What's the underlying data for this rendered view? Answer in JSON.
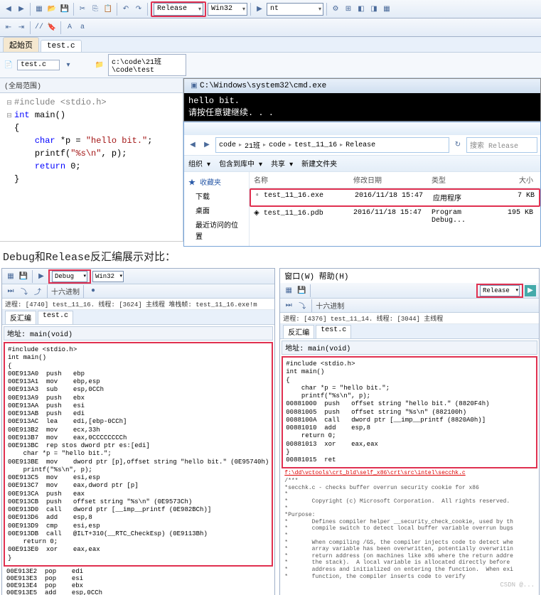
{
  "top_toolbar": {
    "config": "Release",
    "platform": "Win32",
    "target": "nt"
  },
  "tabs": {
    "start": "起始页",
    "file": "test.c"
  },
  "nav": {
    "file": "test.c",
    "path": "c:\\code\\21班\\code\\test"
  },
  "scope": "(全局范围)",
  "code": {
    "l1a": "#include",
    "l1b": "<stdio.h>",
    "l2a": "int",
    "l2b": "main()",
    "l3": "{",
    "l4a": "char",
    "l4b": "*p = ",
    "l4c": "\"hello bit.\"",
    "l4d": ";",
    "l5a": "printf(",
    "l5b": "\"%s\\n\"",
    "l5c": ", p);",
    "l6a": "return",
    "l6b": " 0;",
    "l7": "}"
  },
  "cmd": {
    "title": "C:\\Windows\\system32\\cmd.exe",
    "line1": "hello bit.",
    "line2": "请按任意键继续. . ."
  },
  "explorer": {
    "crumbs": [
      "code",
      "21班",
      "code",
      "test_11_16",
      "Release"
    ],
    "search_ph": "搜索 Release",
    "tb": {
      "org": "组织 ▾",
      "inc": "包含到库中 ▾",
      "share": "共享 ▾",
      "new": "新建文件夹"
    },
    "side": {
      "fav": "收藏夹",
      "dl": "下载",
      "desk": "桌面",
      "recent": "最近访问的位置"
    },
    "cols": {
      "name": "名称",
      "date": "修改日期",
      "type": "类型",
      "size": "大小"
    },
    "rows": [
      {
        "name": "test_11_16.exe",
        "date": "2016/11/18 15:47",
        "type": "应用程序",
        "size": "7 KB"
      },
      {
        "name": "test_11_16.pdb",
        "date": "2016/11/18 15:47",
        "type": "Program Debug...",
        "size": "195 KB"
      }
    ]
  },
  "section_label": "Debug和Release反汇编展示对比：",
  "debug_pane": {
    "config": "Debug",
    "platform": "Win32",
    "status": "进程: [4740] test_11_16.  线程: [3624] 主线程    堆栈帧: test_11_16.exe!m",
    "hex": "十六进制",
    "tab1": "反汇编",
    "tab2": "test.c",
    "addr_hdr": "地址:",
    "addr_val": "main(void)",
    "body": "#include <stdio.h>\nint main()\n{\n00E913A0  push   ebp\n00E913A1  mov    ebp,esp\n00E913A3  sub    esp,0CCh\n00E913A9  push   ebx\n00E913AA  push   esi\n00E913AB  push   edi\n00E913AC  lea    edi,[ebp-0CCh]\n00E913B2  mov    ecx,33h\n00E913B7  mov    eax,0CCCCCCCCh\n00E913BC  rep stos dword ptr es:[edi]\n    char *p = \"hello bit.\";\n00E913BE  mov    dword ptr [p],offset string \"hello bit.\" (0E95740h)\n    printf(\"%s\\n\", p);\n00E913C5  mov    esi,esp\n00E913C7  mov    eax,dword ptr [p]\n00E913CA  push   eax\n00E913CB  push   offset string \"%s\\n\" (0E9573Ch)\n00E913D0  call   dword ptr [__imp__printf (0E982BCh)]\n00E913D6  add    esp,8\n00E913D9  cmp    esi,esp\n00E913DB  call   @ILT+310(__RTC_CheckEsp) (0E9113Bh)\n    return 0;\n00E913E0  xor    eax,eax\n}",
    "tail": "00E913E2  pop    edi\n00E913E3  pop    esi\n00E913E4  pop    ebx\n00E913E5  add    esp,0CCh"
  },
  "release_pane": {
    "menu": "窗口(W)  帮助(H)",
    "config": "Release",
    "hex": "十六进制",
    "status": "进程: [4376] test_11_14.  线程: [3044] 主线程",
    "tab1": "反汇编",
    "tab2": "test.c",
    "addr_hdr": "地址:",
    "addr_val": "main(void)",
    "body": "#include <stdio.h>\nint main()\n{\n    char *p = \"hello bit.\";\n    printf(\"%s\\n\", p);\n00881000  push   offset string \"hello bit.\" (8820F4h)\n00881005  push   offset string \"%s\\n\" (882100h)\n0088100A  call   dword ptr [__imp__printf (8820A0h)]\n00881010  add    esp,8\n    return 0;\n00881013  xor    eax,eax\n}\n00881015  ret",
    "link": "f:\\dd\\vctools\\crt_bld\\self_x86\\crt\\src\\intel\\secchk.c",
    "tail": "/***\n*secchk.c - checks buffer overrun security cookie for x86\n*\n*       Copyright (c) Microsoft Corporation.  All rights reserved.\n*\n*Purpose:\n*       Defines compiler helper __security_check_cookie, used by th\n*       compile switch to detect local buffer variable overrun bugs\n*\n*       When compiling /GS, the compiler injects code to detect whe\n*       array variable has been overwritten, potentially overwritin\n*       return address (on machines like x86 where the return addre\n*       the stack).  A local variable is allocated directly before\n*       address and initialized on entering the function.  When exi\n*       function, the compiler inserts code to verify",
    "watermark": "CSDN @..."
  }
}
